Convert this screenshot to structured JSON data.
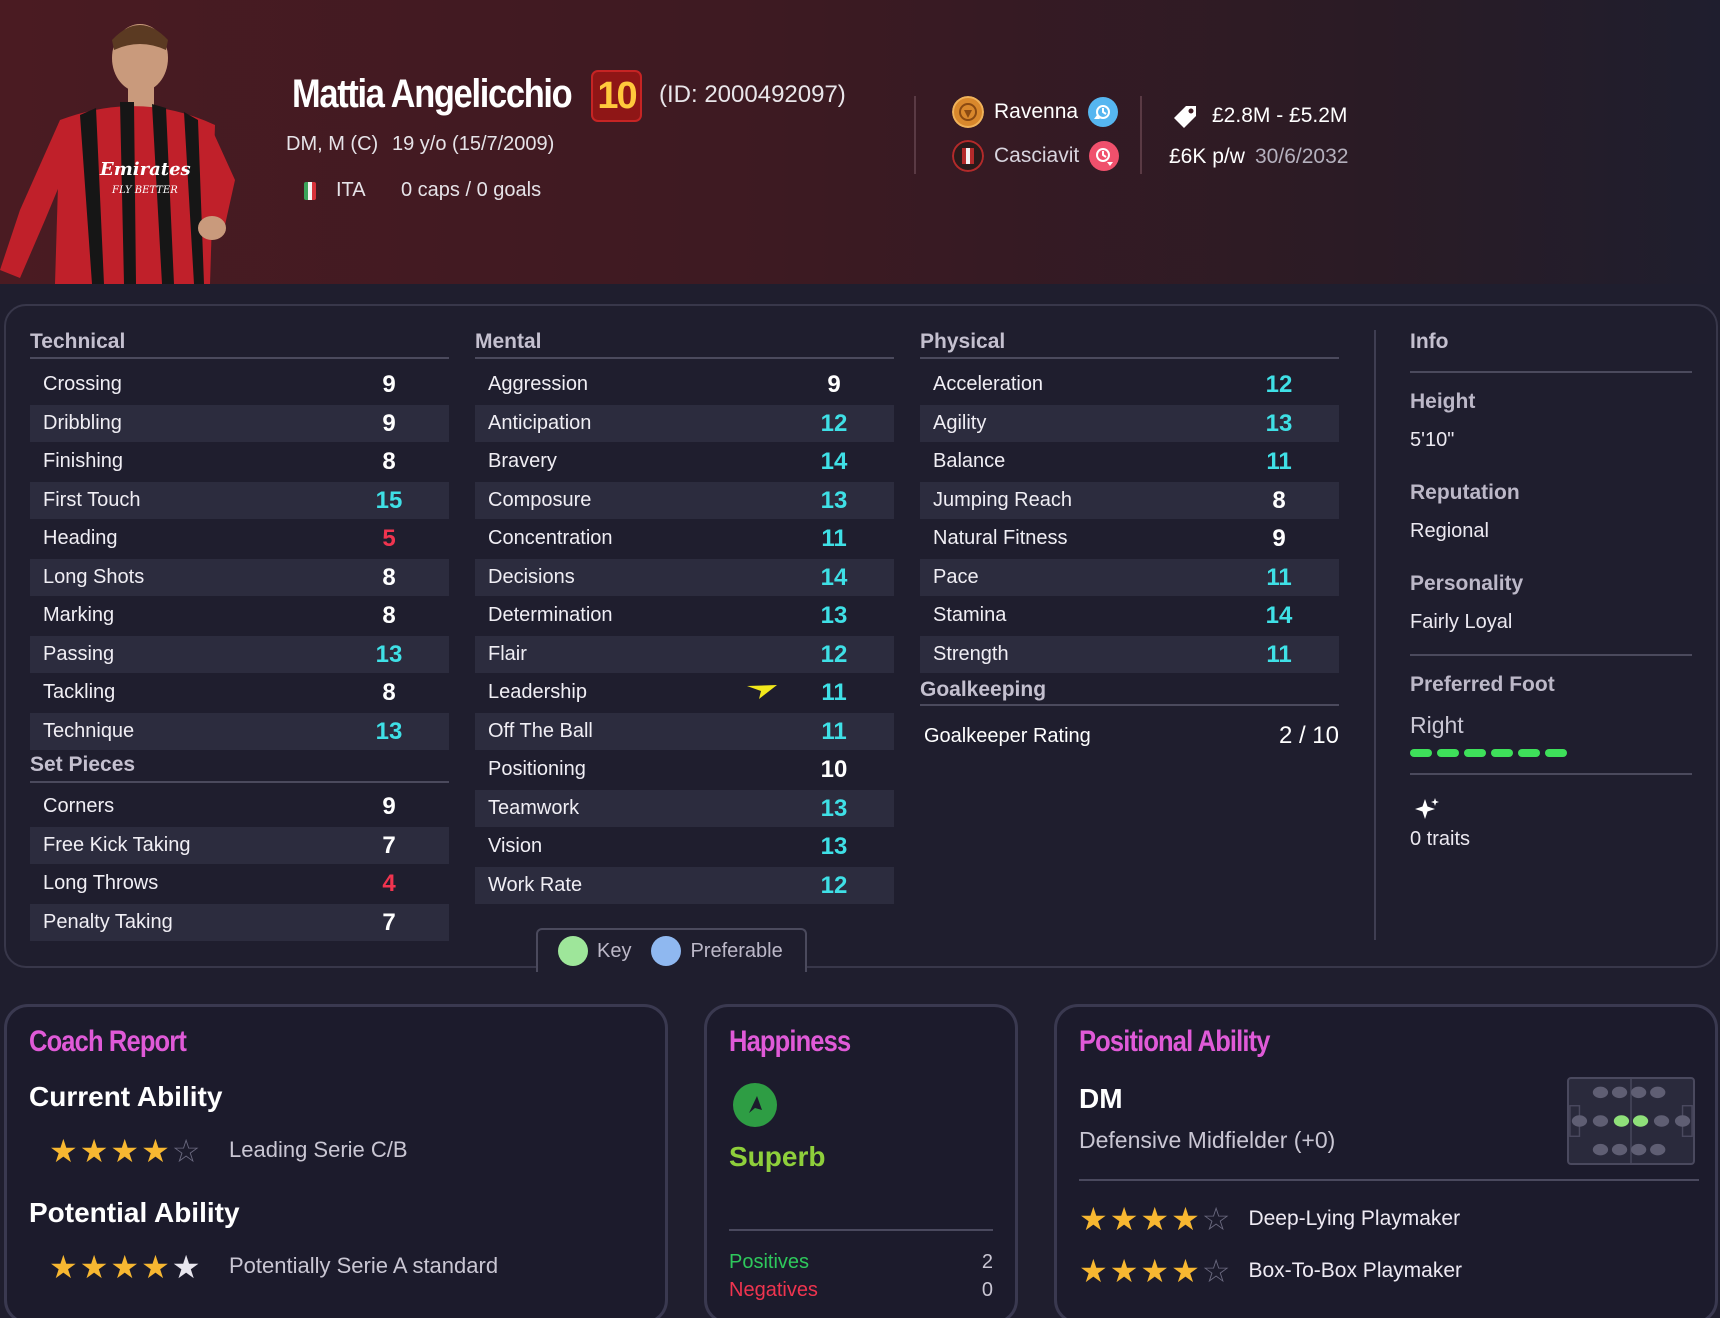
{
  "header": {
    "name": "Mattia Angelicchio",
    "number": "10",
    "id_text": "(ID: 2000492097)",
    "positions": "DM, M (C)",
    "age": "19 y/o (15/7/2009)",
    "nationality": "ITA",
    "caps_goals": "0 caps / 0 goals",
    "loan_club": "Ravenna",
    "parent_club": "Casciavit",
    "value_range": "£2.8M - £5.2M",
    "wage": "£6K p/w",
    "contract_end": "30/6/2032",
    "icons": {
      "loan": "loan-in-icon",
      "parent": "loan-out-icon",
      "value": "price-tag-icon"
    },
    "colors": {
      "loan_icon": "#56b6f0",
      "parent_icon": "#f0506c",
      "number_bg": "#8f1616",
      "number_fg": "#ffc93c"
    }
  },
  "attributes": {
    "technical": {
      "title": "Technical",
      "items": [
        {
          "label": "Crossing",
          "value": "9",
          "tone": "white"
        },
        {
          "label": "Dribbling",
          "value": "9",
          "tone": "white"
        },
        {
          "label": "Finishing",
          "value": "8",
          "tone": "white"
        },
        {
          "label": "First Touch",
          "value": "15",
          "tone": "cyan"
        },
        {
          "label": "Heading",
          "value": "5",
          "tone": "red"
        },
        {
          "label": "Long Shots",
          "value": "8",
          "tone": "white"
        },
        {
          "label": "Marking",
          "value": "8",
          "tone": "white"
        },
        {
          "label": "Passing",
          "value": "13",
          "tone": "cyan"
        },
        {
          "label": "Tackling",
          "value": "8",
          "tone": "white"
        },
        {
          "label": "Technique",
          "value": "13",
          "tone": "cyan"
        }
      ]
    },
    "set_pieces": {
      "title": "Set Pieces",
      "items": [
        {
          "label": "Corners",
          "value": "9",
          "tone": "white"
        },
        {
          "label": "Free Kick Taking",
          "value": "7",
          "tone": "white"
        },
        {
          "label": "Long Throws",
          "value": "4",
          "tone": "red"
        },
        {
          "label": "Penalty Taking",
          "value": "7",
          "tone": "white"
        }
      ]
    },
    "mental": {
      "title": "Mental",
      "items": [
        {
          "label": "Aggression",
          "value": "9",
          "tone": "white"
        },
        {
          "label": "Anticipation",
          "value": "12",
          "tone": "cyan"
        },
        {
          "label": "Bravery",
          "value": "14",
          "tone": "cyan"
        },
        {
          "label": "Composure",
          "value": "13",
          "tone": "cyan"
        },
        {
          "label": "Concentration",
          "value": "11",
          "tone": "cyan"
        },
        {
          "label": "Decisions",
          "value": "14",
          "tone": "cyan"
        },
        {
          "label": "Determination",
          "value": "13",
          "tone": "cyan"
        },
        {
          "label": "Flair",
          "value": "12",
          "tone": "cyan"
        },
        {
          "label": "Leadership",
          "value": "11",
          "tone": "cyan"
        },
        {
          "label": "Off The Ball",
          "value": "11",
          "tone": "cyan"
        },
        {
          "label": "Positioning",
          "value": "10",
          "tone": "white"
        },
        {
          "label": "Teamwork",
          "value": "13",
          "tone": "cyan"
        },
        {
          "label": "Vision",
          "value": "13",
          "tone": "cyan"
        },
        {
          "label": "Work Rate",
          "value": "12",
          "tone": "cyan"
        }
      ]
    },
    "physical": {
      "title": "Physical",
      "items": [
        {
          "label": "Acceleration",
          "value": "12",
          "tone": "cyan"
        },
        {
          "label": "Agility",
          "value": "13",
          "tone": "cyan"
        },
        {
          "label": "Balance",
          "value": "11",
          "tone": "cyan"
        },
        {
          "label": "Jumping Reach",
          "value": "8",
          "tone": "white"
        },
        {
          "label": "Natural Fitness",
          "value": "9",
          "tone": "white"
        },
        {
          "label": "Pace",
          "value": "11",
          "tone": "cyan"
        },
        {
          "label": "Stamina",
          "value": "14",
          "tone": "cyan"
        },
        {
          "label": "Strength",
          "value": "11",
          "tone": "cyan"
        }
      ]
    },
    "goalkeeping": {
      "title": "Goalkeeping",
      "rating_label": "Goalkeeper Rating",
      "rating_value": "2 / 10"
    },
    "tone_colors": {
      "white": "#ffffff",
      "cyan": "#3fe0e6",
      "red": "#f0344f"
    },
    "leadership_marker_icon": "trend-arrow-icon"
  },
  "info": {
    "title": "Info",
    "height_label": "Height",
    "height": "5'10\"",
    "reputation_label": "Reputation",
    "reputation": "Regional",
    "personality_label": "Personality",
    "personality": "Fairly Loyal",
    "foot_label": "Preferred Foot",
    "foot": "Right",
    "traits_icon": "sparkle-icon",
    "traits": "0 traits"
  },
  "legend": {
    "key_label": "Key",
    "key_color": "#9ee69a",
    "preferable_label": "Preferable",
    "preferable_color": "#8fb8f0"
  },
  "coach_report": {
    "title": "Coach Report",
    "current_label": "Current Ability",
    "current_stars": 4,
    "current_desc": "Leading Serie C/B",
    "potential_label": "Potential Ability",
    "potential_stars": 5,
    "potential_desc": "Potentially Serie A standard"
  },
  "happiness": {
    "title": "Happiness",
    "icon": "compass-arrow-icon",
    "status": "Superb",
    "positives_label": "Positives",
    "positives": "2",
    "negatives_label": "Negatives",
    "negatives": "0"
  },
  "positional": {
    "title": "Positional Ability",
    "code": "DM",
    "name": "Defensive Midfielder (+0)",
    "roles": [
      {
        "name": "Deep-Lying Playmaker",
        "stars": 4
      },
      {
        "name": "Box-To-Box Playmaker",
        "stars": 4
      }
    ]
  }
}
